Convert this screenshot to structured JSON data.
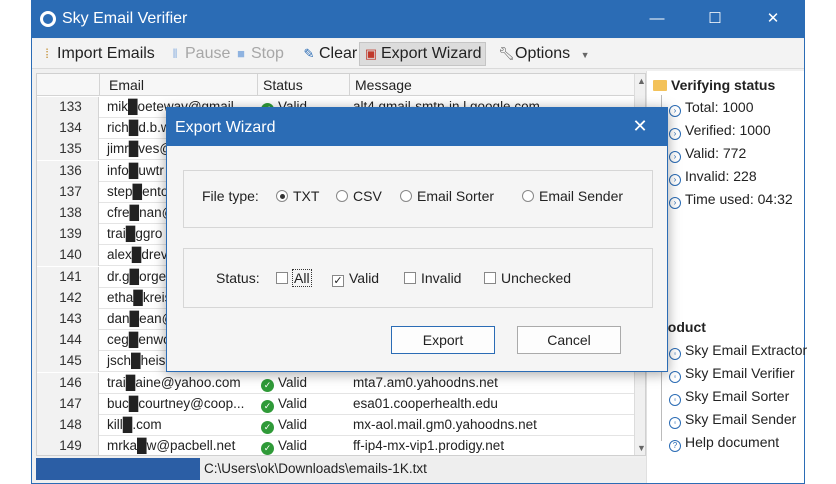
{
  "window": {
    "title": "Sky Email Verifier",
    "controls": {
      "minimize": "—",
      "maximize": "☐",
      "close": "✕"
    }
  },
  "toolbar": {
    "import": "Import Emails",
    "pause": "Pause",
    "stop": "Stop",
    "clear": "Clear",
    "export": "Export Wizard",
    "options": "Options"
  },
  "grid": {
    "headers": {
      "email": "Email",
      "status": "Status",
      "message": "Message"
    },
    "rows": [
      {
        "num": "133",
        "email": "mik█oetewav@gmail",
        "status": "Valid",
        "msg": "alt4.gmail-smtp-in.l.google.com"
      },
      {
        "num": "134",
        "email": "rich█d.b.w",
        "status": "",
        "msg": ""
      },
      {
        "num": "135",
        "email": "jimr█ves@",
        "status": "",
        "msg": ""
      },
      {
        "num": "136",
        "email": "info█uwtr",
        "status": "",
        "msg": ""
      },
      {
        "num": "137",
        "email": "step█entor",
        "status": "",
        "msg": ""
      },
      {
        "num": "138",
        "email": "cfre█nan@",
        "status": "",
        "msg": ""
      },
      {
        "num": "139",
        "email": "trai█ggro",
        "status": "",
        "msg": ""
      },
      {
        "num": "140",
        "email": "alex█drev",
        "status": "",
        "msg": ""
      },
      {
        "num": "141",
        "email": "dr.g█orge",
        "status": "",
        "msg": ""
      },
      {
        "num": "142",
        "email": "etha█kreis",
        "status": "",
        "msg": ""
      },
      {
        "num": "143",
        "email": "dan█ean@",
        "status": "",
        "msg": ""
      },
      {
        "num": "144",
        "email": "ceg█enwo",
        "status": "",
        "msg": ""
      },
      {
        "num": "145",
        "email": "jsch█heis",
        "status": "",
        "msg": ""
      },
      {
        "num": "146",
        "email": "trai█aine@yahoo.com",
        "status": "Valid",
        "msg": "mta7.am0.yahoodns.net"
      },
      {
        "num": "147",
        "email": "buc█courtney@coop...",
        "status": "Valid",
        "msg": "esa01.cooperhealth.edu"
      },
      {
        "num": "148",
        "email": "kill█.com",
        "status": "Valid",
        "msg": "mx-aol.mail.gm0.yahoodns.net"
      },
      {
        "num": "149",
        "email": "mrka█w@pacbell.net",
        "status": "Valid",
        "msg": "ff-ip4-mx-vip1.prodigy.net"
      }
    ]
  },
  "statusbar": {
    "path": "C:\\Users\\ok\\Downloads\\emails-1K.txt"
  },
  "sidepanel": {
    "verifying_title": "Verifying status",
    "stats": [
      "Total: 1000",
      "Verified: 1000",
      "Valid: 772",
      "Invalid: 228",
      "Time used: 04:32"
    ],
    "product_title": "Product",
    "products": [
      "Sky Email Extractor",
      "Sky Email Verifier",
      "Sky Email Sorter",
      "Sky Email Sender",
      "Help document"
    ]
  },
  "dialog": {
    "title": "Export Wizard",
    "close": "✕",
    "file_type_label": "File type:",
    "file_types": [
      "TXT",
      "CSV",
      "Email Sorter",
      "Email Sender"
    ],
    "selected_file_type": "TXT",
    "status_label": "Status:",
    "status_options": [
      {
        "label": "All",
        "checked": false
      },
      {
        "label": "Valid",
        "checked": true
      },
      {
        "label": "Invalid",
        "checked": false
      },
      {
        "label": "Unchecked",
        "checked": false
      }
    ],
    "export_button": "Export",
    "cancel_button": "Cancel"
  },
  "colors": {
    "accent": "#2b6cb5",
    "valid": "#2f9a38",
    "progress": "#2b5ea5"
  }
}
